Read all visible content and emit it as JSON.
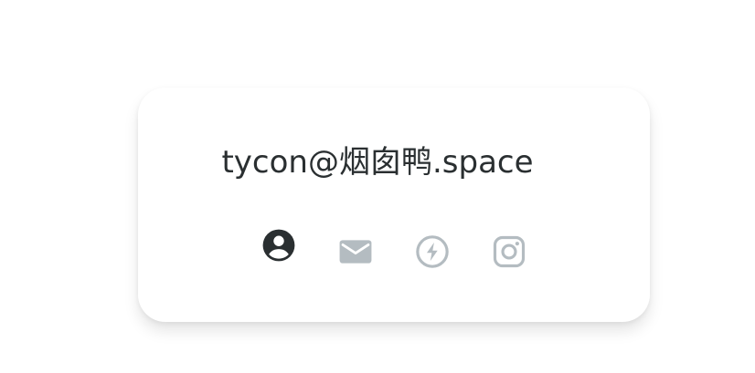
{
  "contact": {
    "handle": "tycon@烟囱鸭.space"
  },
  "icons": [
    {
      "name": "account-circle-icon",
      "color": "#2a2f31",
      "active": true
    },
    {
      "name": "email-icon",
      "color": "#b4bcc1",
      "active": false
    },
    {
      "name": "lightning-circle-icon",
      "color": "#b4bcc1",
      "active": false
    },
    {
      "name": "instagram-icon",
      "color": "#b4bcc1",
      "active": false
    }
  ],
  "colors": {
    "background": "#ffffff",
    "card": "#ffffff",
    "text": "#2a2f31",
    "icon_active": "#2a2f31",
    "icon_inactive": "#b4bcc1"
  }
}
